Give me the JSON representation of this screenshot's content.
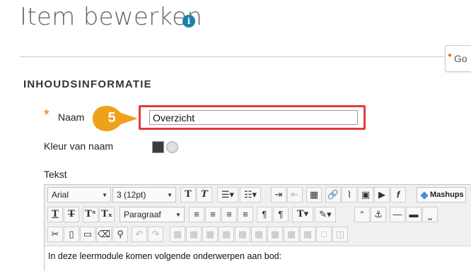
{
  "page": {
    "title": "Item bewerken",
    "topright_partial": "Go"
  },
  "section": {
    "heading": "INHOUDSINFORMATIE"
  },
  "form": {
    "required_mark": "*",
    "name_label": "Naam",
    "name_value": "Overzicht",
    "callout_number": "5",
    "color_label": "Kleur van naam",
    "text_label": "Tekst"
  },
  "editor": {
    "font_family": "Arial",
    "font_size": "3 (12pt)",
    "paragraph_style": "Paragraaf",
    "mashups_label": "Mashups",
    "content": "In deze leermodule komen volgende onderwerpen aan bod:"
  },
  "colors": {
    "accent_orange": "#e8720c",
    "highlight_red": "#e03c3c",
    "info_blue": "#1f80a8",
    "callout_orange": "#f0a11c",
    "swatch": "#3c3c3c"
  }
}
